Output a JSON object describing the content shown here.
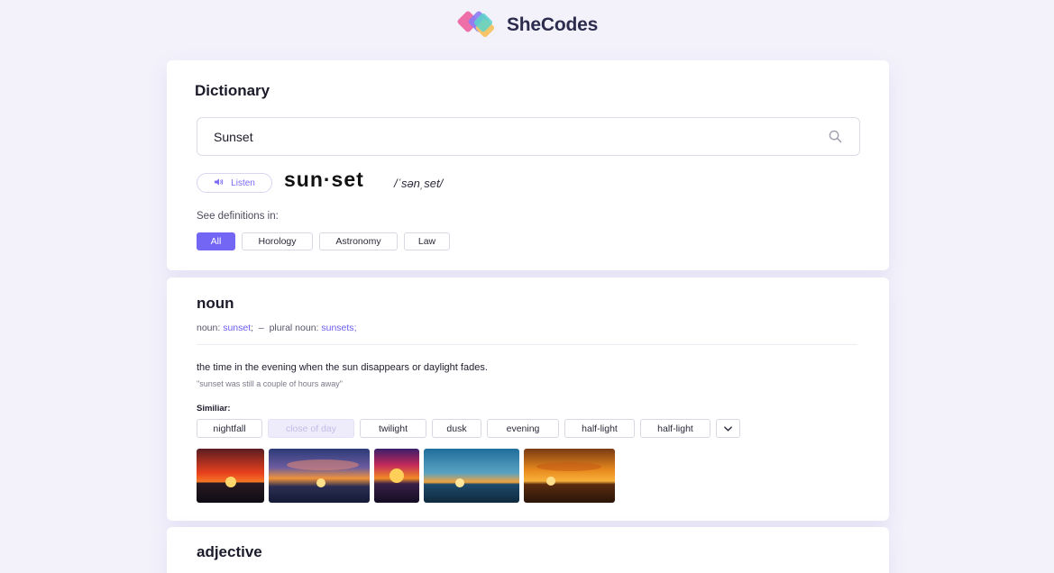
{
  "brand": {
    "name": "SheCodes"
  },
  "search_card": {
    "title": "Dictionary",
    "search": {
      "value": "Sunset",
      "icon": "search-icon"
    },
    "listen_label": "Listen",
    "word": "sun·set",
    "phonetic": "/ˈsənˌset/",
    "see_definitions": "See definitions in:",
    "filters": [
      "All",
      "Horology",
      "Astronomy",
      "Law"
    ],
    "active_filter": "All"
  },
  "noun_card": {
    "title": "noun",
    "forms": {
      "noun_label": "noun:",
      "noun_value": "sunset",
      "separator": ";  –  ",
      "plural_label": "plural noun:",
      "plural_value": "sunsets",
      "end": ";"
    },
    "definition": "the time in the evening when the sun disappears or daylight fades.",
    "example": "\"sunset was still a couple of hours away\"",
    "similar_label": "Similiar:",
    "similar": [
      "nightfall",
      "close of day",
      "twilight",
      "dusk",
      "evening",
      "half-light",
      "half-light"
    ],
    "muted_chip": "close of day",
    "images": [
      "sunset-image-1",
      "sunset-image-2",
      "sunset-image-3",
      "sunset-image-4",
      "sunset-image-5"
    ]
  },
  "adjective_card": {
    "title": "adjective"
  },
  "colors": {
    "accent": "#7466f4",
    "link": "#6a5cf0",
    "background": "#f3f2fb"
  }
}
